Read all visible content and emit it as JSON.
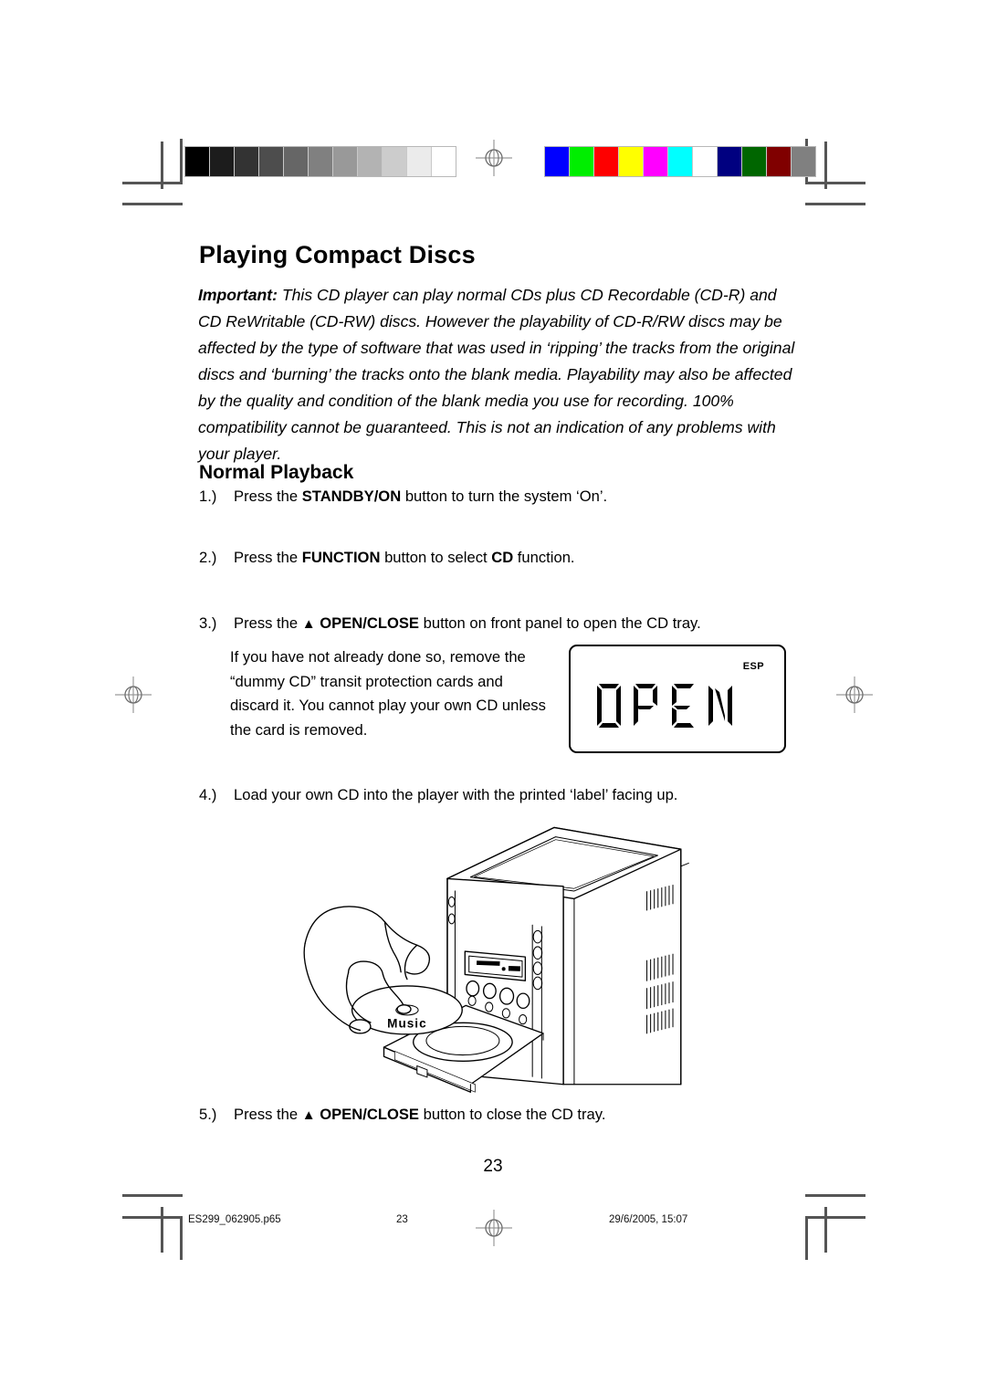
{
  "document": {
    "title": "Playing Compact Discs",
    "page_number": "23"
  },
  "important": {
    "label": "Important:",
    "text": " This CD player can play normal CDs plus CD Recordable (CD-R) and CD ReWritable (CD-RW) discs. However the playability of CD-R/RW discs may be affected by the type of software that was used in ‘ripping’ the tracks from the original discs and ‘burning’ the tracks onto the blank media. Playability may also be affected by the quality and condition of the blank media you use for recording. 100% compatibility cannot be guaranteed. This is not an indication of any problems with your player."
  },
  "section": {
    "heading": "Normal Playback"
  },
  "steps": [
    {
      "num": "1.)",
      "pre": "Press the ",
      "bold1": "STANDBY/ON",
      "mid": " button to turn the system ‘On’.",
      "bold2": "",
      "post": ""
    },
    {
      "num": "2.)",
      "pre": "Press the ",
      "bold1": "FUNCTION",
      "mid": " button to select ",
      "bold2": "CD",
      "post": " function."
    },
    {
      "num": "3.)",
      "pre": "Press the ",
      "eject": "▲",
      "bold1": "OPEN/CLOSE",
      "mid": " button on front panel to open the CD tray.",
      "bold2": "",
      "post": ""
    },
    {
      "num": "4.)",
      "pre": "Load your own CD into the player with the printed ‘label’ facing up.",
      "bold1": "",
      "mid": "",
      "bold2": "",
      "post": ""
    },
    {
      "num": "5.)",
      "pre": "Press the ",
      "eject": "▲",
      "bold1": "OPEN/CLOSE",
      "mid": " button to close the CD tray.",
      "bold2": "",
      "post": ""
    }
  ],
  "note": {
    "line1": "If you have not already done so, remove the",
    "line2": "“dummy CD” transit protection cards and",
    "line3": "discard it. You cannot play your own CD unless",
    "line4": "the card is removed."
  },
  "lcd_display": {
    "main_text": "OPEN",
    "indicator": "ESP"
  },
  "illustration": {
    "cd_label": "Music",
    "subject": "hand loading compact disc into micro hi-fi CD tray"
  },
  "footer": {
    "file_name": "ES299_062905.p65",
    "page": "23",
    "timestamp": "29/6/2005, 15:07"
  },
  "calibration": {
    "grayscale_swatches": [
      "#000000",
      "#1c1c1c",
      "#333333",
      "#4d4d4d",
      "#666666",
      "#808080",
      "#999999",
      "#b3b3b3",
      "#cccccc",
      "#ebebeb",
      "#ffffff"
    ],
    "color_swatches": [
      "#0000ff",
      "#00ee00",
      "#fe0000",
      "#ffff00",
      "#ff00ff",
      "#00ffff",
      "#ffffff",
      "#000080",
      "#006600",
      "#800000",
      "#808080"
    ]
  }
}
